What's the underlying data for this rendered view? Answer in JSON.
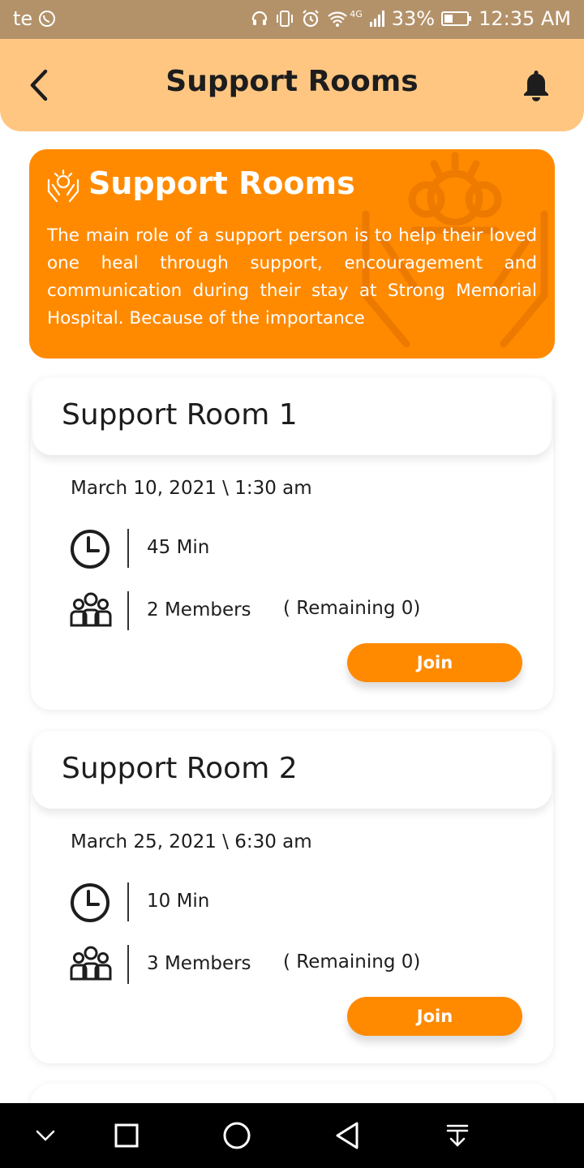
{
  "status_bar": {
    "left_text": "te",
    "network": "4G",
    "battery": "33%",
    "time": "12:35 AM"
  },
  "app_bar": {
    "title": "Support Rooms",
    "back_icon": "chevron-left-icon",
    "bell_icon": "bell-icon"
  },
  "banner": {
    "title": "Support Rooms",
    "icon": "hands-heart-icon",
    "description": "The main role of a support person is to help their loved one heal through support, encouragement and communication during their stay at Strong Memorial Hospital. Because of the importance",
    "background_color": "#ff8a00"
  },
  "rooms": [
    {
      "name": "Support Room 1",
      "date": "March 10, 2021 \\ 1:30 am",
      "duration": "45 Min",
      "members": "2 Members",
      "remaining": "( Remaining 0)",
      "join_label": "Join"
    },
    {
      "name": "Support Room 2",
      "date": "March 25, 2021 \\ 6:30 am",
      "duration": "10 Min",
      "members": "3 Members",
      "remaining": "( Remaining 0)",
      "join_label": "Join"
    }
  ],
  "colors": {
    "accent": "#ff8a00",
    "app_bar": "#ffc682",
    "status_bar": "#b3926a"
  },
  "nav_bar": [
    "chevron-down-icon",
    "square-icon",
    "circle-icon",
    "triangle-back-icon",
    "download-icon"
  ]
}
